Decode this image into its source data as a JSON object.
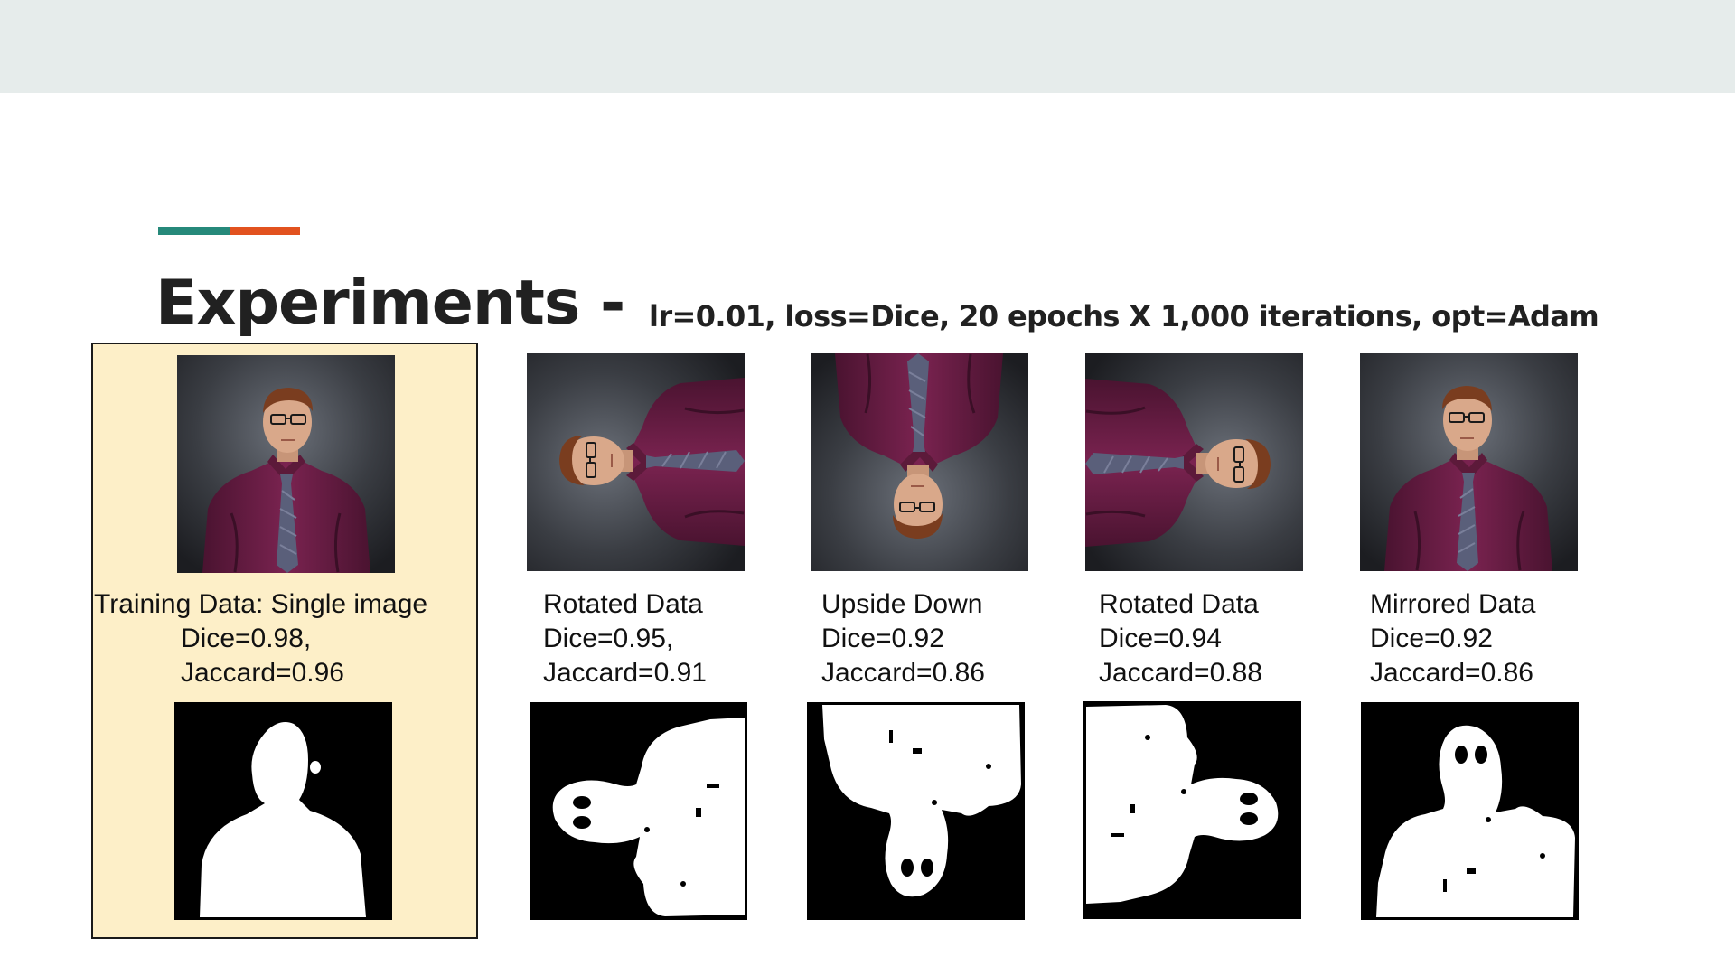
{
  "slide": {
    "title": "Experiments -",
    "subtitle": "lr=0.01, loss=Dice, 20 epochs X 1,000 iterations, opt=Adam"
  },
  "colors": {
    "top_band": "#e6eceb",
    "accent_teal": "#26897a",
    "accent_orange": "#e2521f",
    "highlight_fill": "#fdefc8",
    "shirt": "#6e1f45",
    "background_photo": "#3b3e44"
  },
  "experiments": [
    {
      "caption_line1": "Training Data: Single image",
      "caption_line2": "Dice=0.98,",
      "caption_line3": "Jaccard=0.96",
      "orientation": "upright",
      "highlighted": true
    },
    {
      "caption_line1": "Rotated Data",
      "caption_line2": "Dice=0.95,",
      "caption_line3": "Jaccard=0.91",
      "orientation": "rotated-90-ccw"
    },
    {
      "caption_line1": "Upside Down",
      "caption_line2": "Dice=0.92",
      "caption_line3": "Jaccard=0.86",
      "orientation": "upside-down"
    },
    {
      "caption_line1": "Rotated Data",
      "caption_line2": "Dice=0.94",
      "caption_line3": "Jaccard=0.88",
      "orientation": "rotated-90-cw"
    },
    {
      "caption_line1": "Mirrored Data",
      "caption_line2": "Dice=0.92",
      "caption_line3": "Jaccard=0.86",
      "orientation": "mirrored"
    }
  ]
}
